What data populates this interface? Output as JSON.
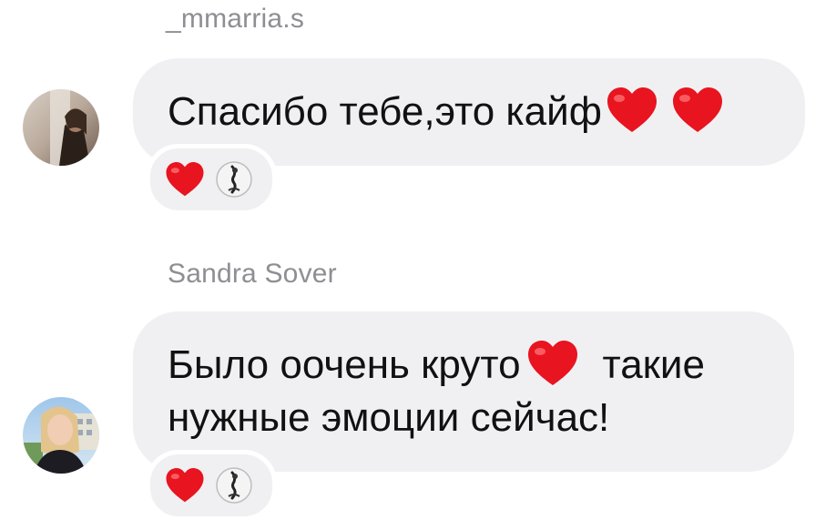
{
  "messages": [
    {
      "sender": "_mmarria.s",
      "text_lines": [
        "Спасибо тебе,это кайф"
      ],
      "text_emoji": [
        "heart-emoji",
        "heart-emoji"
      ]
    },
    {
      "sender": "Sandra Sover",
      "text_lines": [
        "Было оочень круто",
        "такие",
        "нужные эмоции сейчас!"
      ],
      "text_emoji": [
        "heart-emoji"
      ]
    }
  ],
  "colors": {
    "bubble": "#f0f0f3",
    "sender": "#8e8e93",
    "text": "#111111",
    "heart": "#e8141f"
  }
}
